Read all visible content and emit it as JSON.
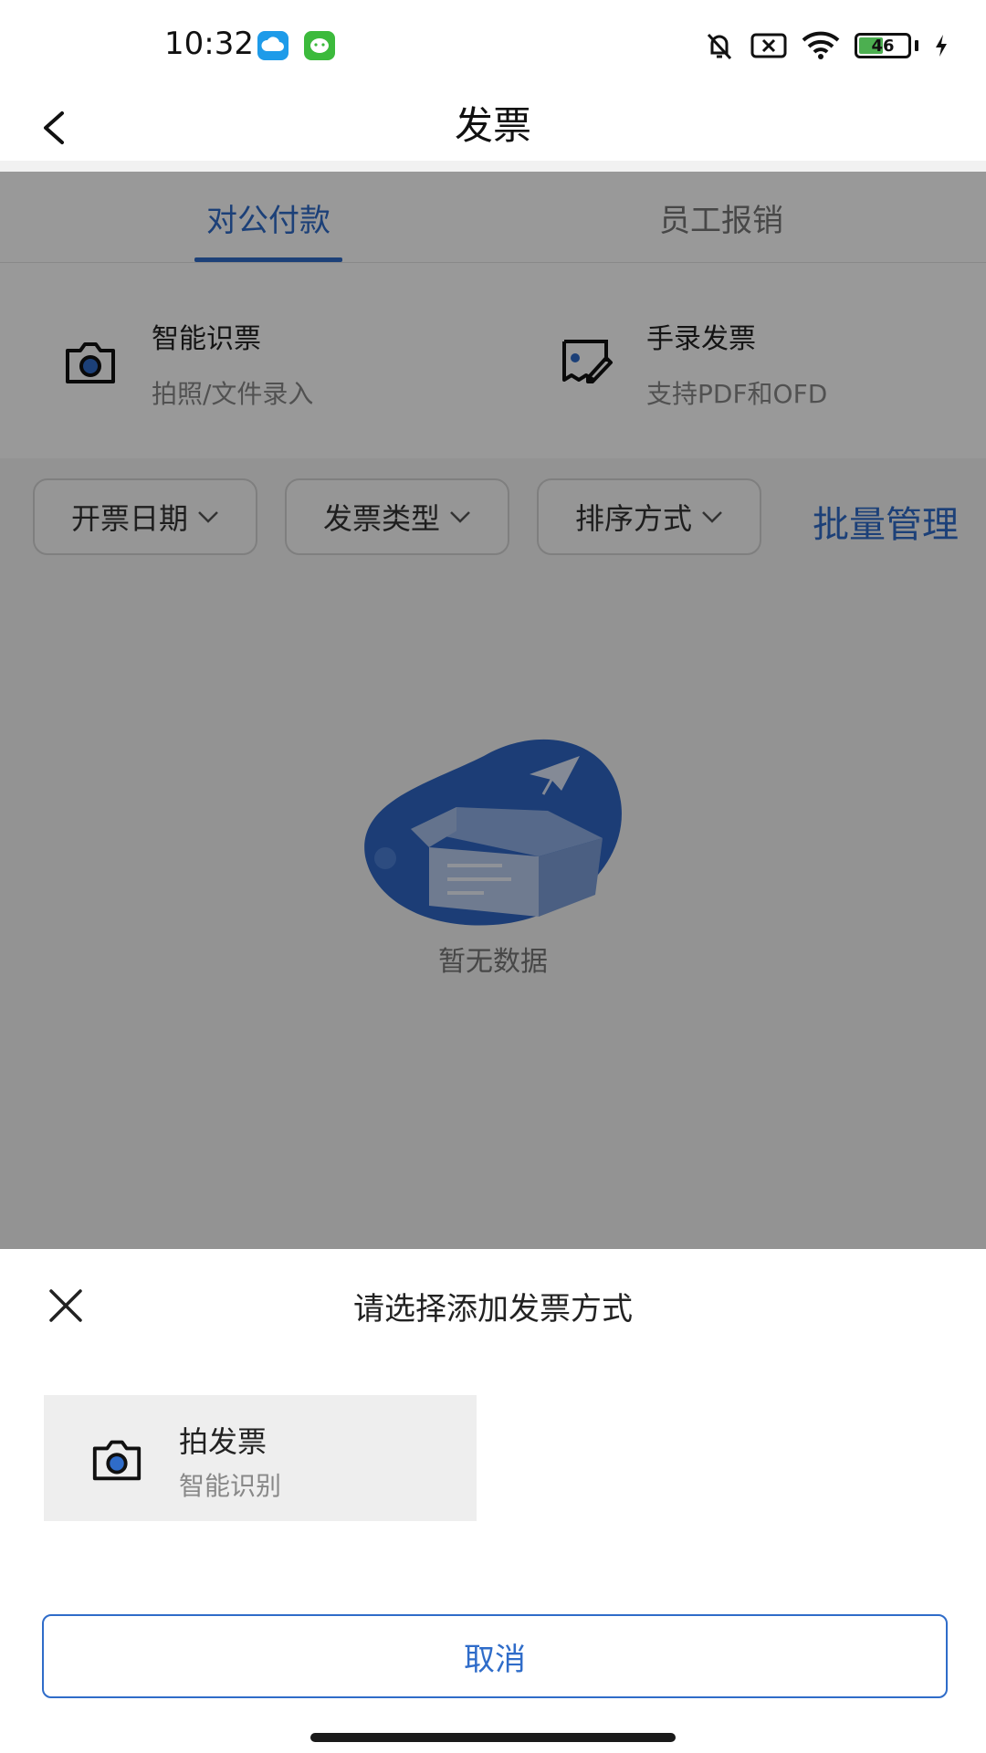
{
  "status_bar": {
    "time": "10:32",
    "battery": "46",
    "icons": [
      "cloud-app-icon",
      "wechat-app-icon",
      "mute-bell-icon",
      "sim-off-icon",
      "wifi-icon",
      "battery-icon",
      "charging-icon"
    ]
  },
  "header": {
    "title": "发票",
    "back_icon": "chevron-left-icon"
  },
  "tabs": [
    {
      "label": "对公付款",
      "active": true
    },
    {
      "label": "员工报销",
      "active": false
    }
  ],
  "actions": [
    {
      "title": "智能识票",
      "subtitle": "拍照/文件录入",
      "icon": "camera-icon"
    },
    {
      "title": "手录发票",
      "subtitle": "支持PDF和OFD",
      "icon": "invoice-edit-icon"
    }
  ],
  "filters": [
    {
      "label": "开票日期"
    },
    {
      "label": "发票类型"
    },
    {
      "label": "排序方式"
    }
  ],
  "batch_manage": "批量管理",
  "empty_state": {
    "text": "暂无数据",
    "icon": "empty-box-icon"
  },
  "sheet": {
    "title": "请选择添加发票方式",
    "close_icon": "close-icon",
    "option": {
      "title": "拍发票",
      "subtitle": "智能识别",
      "icon": "camera-icon"
    },
    "cancel": "取消"
  },
  "colors": {
    "accent": "#2f6cc9",
    "overlay": "rgba(0,0,0,0.40)",
    "battery": "#4caf50"
  }
}
